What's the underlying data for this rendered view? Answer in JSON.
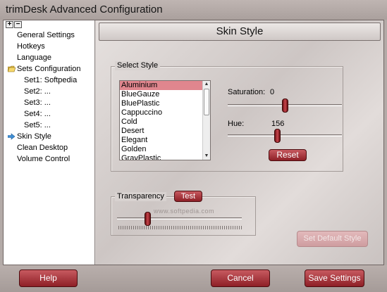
{
  "window": {
    "title": "trimDesk Advanced Configuration"
  },
  "tree": {
    "expand_label": "+",
    "collapse_label": "−",
    "items": [
      {
        "label": "General Settings"
      },
      {
        "label": "Hotkeys"
      },
      {
        "label": "Language"
      },
      {
        "label": "Sets Configuration"
      },
      {
        "label": "Set1: Softpedia"
      },
      {
        "label": "Set2: ..."
      },
      {
        "label": "Set3: ..."
      },
      {
        "label": "Set4: ..."
      },
      {
        "label": "Set5: ..."
      },
      {
        "label": "Skin Style"
      },
      {
        "label": "Clean Desktop"
      },
      {
        "label": "Volume Control"
      }
    ],
    "selected": "Skin Style",
    "icons": {
      "folder": "folder-open-icon",
      "current": "arrow-right-icon"
    }
  },
  "panel": {
    "title": "Skin Style"
  },
  "select_style": {
    "legend": "Select Style",
    "styles": [
      "Aluminium",
      "BlueGauze",
      "BluePlastic",
      "Cappuccino",
      "Cold",
      "Desert",
      "Elegant",
      "Golden",
      "GrayPlastic"
    ],
    "selected": "Aluminium",
    "saturation_label": "Saturation:",
    "saturation_value": "0",
    "hue_label": "Hue:",
    "hue_value": "156",
    "saturation_level": 0.5,
    "hue_level": 0.43,
    "reset_label": "Reset"
  },
  "transparency": {
    "label": "Transparency",
    "test_label": "Test",
    "level": 0.23
  },
  "watermark": "www.softpedia.com",
  "set_default_label": "Set Default Style",
  "buttons": {
    "help": "Help",
    "cancel": "Cancel",
    "save": "Save Settings"
  },
  "colors": {
    "accent": "#9b2a31",
    "selection": "#e0868e",
    "window": "#b3aaa7"
  }
}
